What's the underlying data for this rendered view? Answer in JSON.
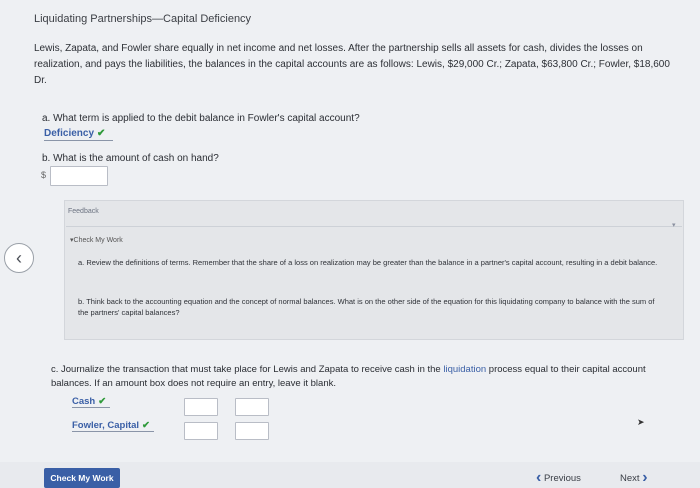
{
  "header": {
    "title": "Liquidating Partnerships—Capital Deficiency"
  },
  "problem": {
    "intro": "Lewis, Zapata, and Fowler share equally in net income and net losses. After the partnership sells all assets for cash, divides the losses on realization, and pays the liabilities, the balances in the capital accounts are as follows: Lewis, $29,000 Cr.; Zapata, $63,800 Cr.; Fowler, $18,600 Dr."
  },
  "part_a": {
    "question": "a. What term is applied to the debit balance in Fowler's capital account?",
    "answer": "Deficiency",
    "check": "✔"
  },
  "part_b": {
    "question": "b. What is the amount of cash on hand?",
    "currency": "$",
    "cash_value": ""
  },
  "feedback": {
    "label": "Feedback",
    "check_my_work": "▾Check My Work",
    "hint_a": "a. Review the definitions of terms. Remember that the share of a loss on realization may be greater than the balance in a partner's capital account, resulting in a debit balance.",
    "hint_b": "b. Think back to the accounting equation and the concept of normal balances. What is on the other side of the equation for this liquidating company to balance with the sum of the partners' capital balances?"
  },
  "part_c": {
    "question_pre": "c. Journalize the transaction that must take place for Lewis and Zapata to receive cash in the ",
    "question_highlight": "liquidation",
    "question_post": " process equal to their capital account balances. If an amount box does not require an entry, leave it blank.",
    "rows": [
      {
        "account": "Cash",
        "check": "✔",
        "debit": "",
        "credit": ""
      },
      {
        "account": "Fowler, Capital",
        "check": "✔",
        "debit": "",
        "credit": ""
      }
    ]
  },
  "footer": {
    "check_my_work_label": "Check My Work",
    "previous_label": "Previous",
    "next_label": "Next"
  },
  "icons": {
    "prev_chevron": "chevron-left-icon",
    "check": "checkmark-icon",
    "cursor": "mouse-cursor-icon"
  },
  "colors": {
    "accent": "#3a5fa6",
    "check": "#2f9a3a"
  }
}
